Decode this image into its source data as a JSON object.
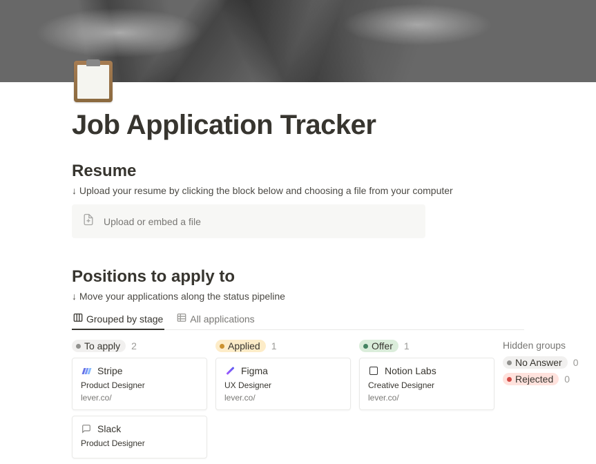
{
  "page": {
    "title": "Job Application Tracker"
  },
  "resume": {
    "heading": "Resume",
    "help": "↓ Upload your resume by clicking the block below and choosing a file from your computer",
    "upload_label": "Upload or embed a file"
  },
  "positions": {
    "heading": "Positions to apply to",
    "help": "↓ Move your applications along the status pipeline"
  },
  "tabs": {
    "grouped": "Grouped by stage",
    "all": "All applications"
  },
  "board": {
    "columns": [
      {
        "stage": "To apply",
        "color": "gray",
        "count": "2",
        "cards": [
          {
            "company": "Stripe",
            "role": "Product Designer",
            "link": "lever.co/",
            "icon": "stripe"
          },
          {
            "company": "Slack",
            "role": "Product Designer",
            "link": "",
            "icon": "slack"
          }
        ]
      },
      {
        "stage": "Applied",
        "color": "yellow",
        "count": "1",
        "cards": [
          {
            "company": "Figma",
            "role": "UX Designer",
            "link": "lever.co/",
            "icon": "figma"
          }
        ]
      },
      {
        "stage": "Offer",
        "color": "green",
        "count": "1",
        "cards": [
          {
            "company": "Notion Labs",
            "role": "Creative Designer",
            "link": "lever.co/",
            "icon": "notion"
          }
        ]
      }
    ]
  },
  "hidden": {
    "title": "Hidden groups",
    "groups": [
      {
        "stage": "No Answer",
        "color": "gray",
        "count": "0"
      },
      {
        "stage": "Rejected",
        "color": "red",
        "count": "0"
      }
    ]
  }
}
